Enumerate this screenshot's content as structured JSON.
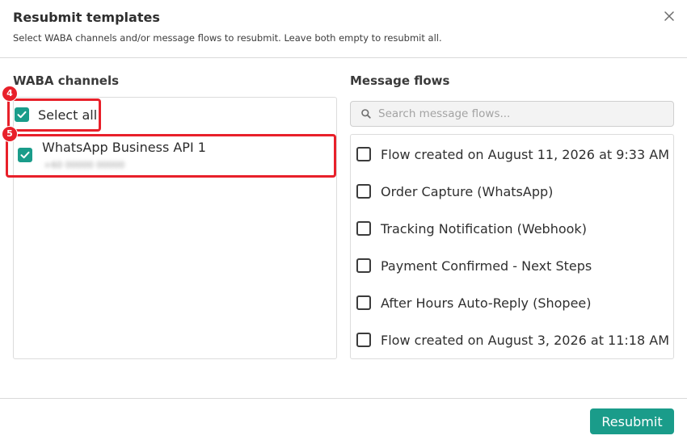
{
  "dialog": {
    "title": "Resubmit templates",
    "subtitle": "Select WABA channels and/or message flows to resubmit. Leave both empty to resubmit all."
  },
  "channels": {
    "title": "WABA channels",
    "select_all_label": "Select all",
    "select_all_checked": true,
    "items": [
      {
        "name": "WhatsApp Business API 1",
        "subtext": "+60 00000 00000",
        "checked": true
      }
    ]
  },
  "flows": {
    "title": "Message flows",
    "search_placeholder": "Search message flows...",
    "items": [
      {
        "label": "Flow created on August 11, 2026 at 9:33 AM",
        "checked": false
      },
      {
        "label": "Order Capture (WhatsApp)",
        "checked": false
      },
      {
        "label": "Tracking Notification (Webhook)",
        "checked": false
      },
      {
        "label": "Payment Confirmed - Next Steps",
        "checked": false
      },
      {
        "label": "After Hours Auto-Reply (Shopee)",
        "checked": false
      },
      {
        "label": "Flow created on August 3, 2026 at 11:18 AM",
        "checked": false
      }
    ]
  },
  "annotations": {
    "badge_4": "4",
    "badge_5": "5"
  },
  "footer": {
    "resubmit_label": "Resubmit"
  },
  "colors": {
    "accent": "#1a9c8a",
    "highlight": "#e8202a"
  },
  "icons": {
    "close": "close-icon",
    "search": "search-icon",
    "check": "checkmark-icon"
  }
}
